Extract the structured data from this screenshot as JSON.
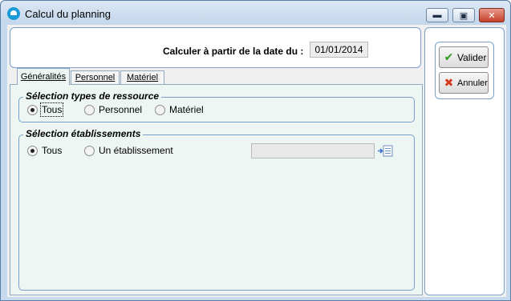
{
  "window": {
    "title": "Calcul du planning"
  },
  "header": {
    "date_label": "Calculer à partir de la date du :",
    "date_value": "01/01/2014"
  },
  "actions": {
    "validate_label": "Valider",
    "cancel_label": "Annuler"
  },
  "tabs": [
    {
      "label": "Généralités",
      "active": true
    },
    {
      "label": "Personnel",
      "active": false
    },
    {
      "label": "Matériel",
      "active": false
    }
  ],
  "resource_types": {
    "title": "Sélection types de ressource",
    "options": [
      {
        "label": "Tous",
        "selected": true
      },
      {
        "label": "Personnel",
        "selected": false
      },
      {
        "label": "Matériel",
        "selected": false
      }
    ]
  },
  "establishments": {
    "title": "Sélection établissements",
    "options": [
      {
        "label": "Tous",
        "selected": true
      },
      {
        "label": "Un établissement",
        "selected": false
      }
    ],
    "field_value": ""
  },
  "colors": {
    "window_frame": "#c7d9ec",
    "panel_border": "#7aa0c8",
    "tab_page_bg": "#eef6f4",
    "validate_icon": "#2f9a1c",
    "cancel_icon": "#d63a1e"
  }
}
